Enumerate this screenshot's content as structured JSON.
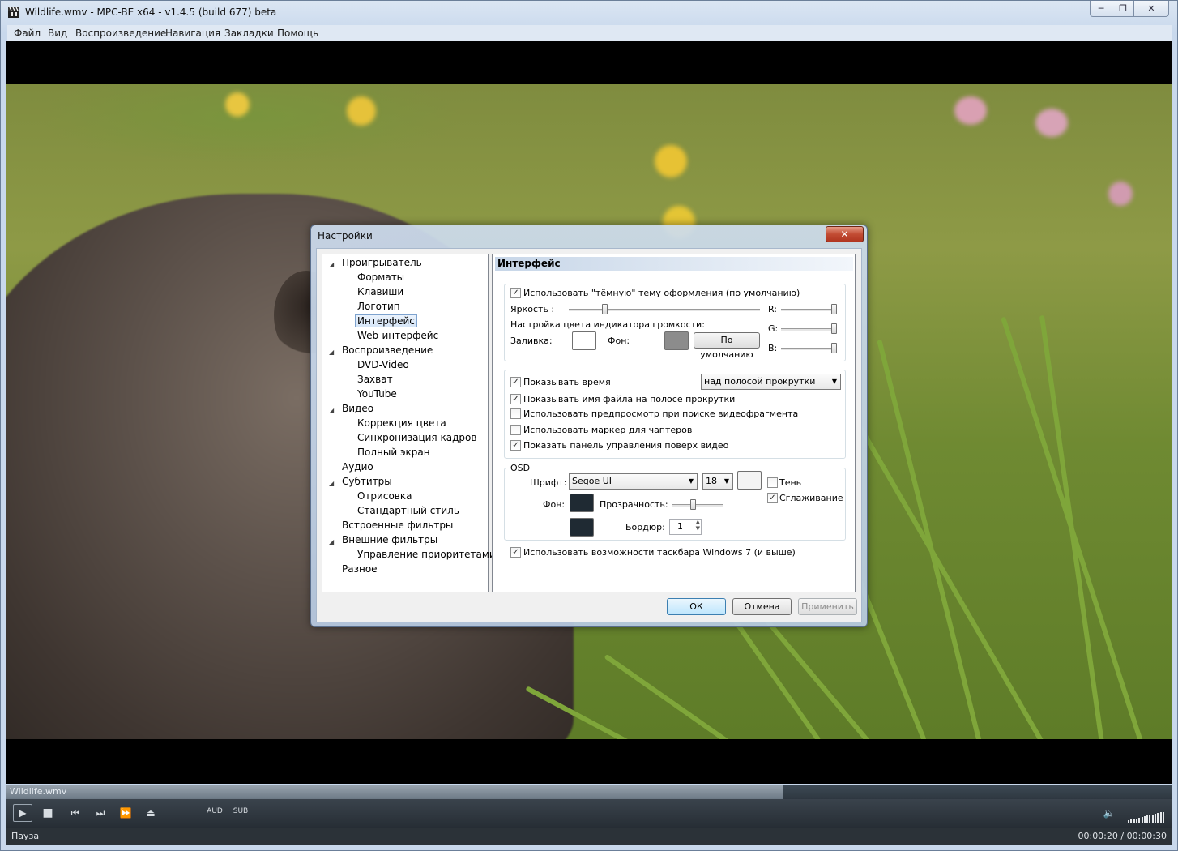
{
  "window": {
    "title": "Wildlife.wmv - MPC-BE x64 - v1.4.5 (build 677) beta"
  },
  "menu": [
    "Файл",
    "Вид",
    "Воспроизведение",
    "Навигация",
    "Закладки",
    "Помощь"
  ],
  "dialog": {
    "title": "Настройки",
    "tree": [
      {
        "label": "Проигрыватель"
      },
      {
        "label": "Форматы"
      },
      {
        "label": "Клавиши"
      },
      {
        "label": "Логотип"
      },
      {
        "label": "Интерфейс",
        "selected": true
      },
      {
        "label": "Web-интерфейс"
      },
      {
        "label": "Воспроизведение"
      },
      {
        "label": "DVD-Video"
      },
      {
        "label": "Захват"
      },
      {
        "label": "YouTube"
      },
      {
        "label": "Видео"
      },
      {
        "label": "Коррекция цвета"
      },
      {
        "label": "Синхронизация кадров"
      },
      {
        "label": "Полный экран"
      },
      {
        "label": "Аудио"
      },
      {
        "label": "Субтитры"
      },
      {
        "label": "Отрисовка"
      },
      {
        "label": "Стандартный стиль"
      },
      {
        "label": "Встроенные фильтры"
      },
      {
        "label": "Внешние фильтры"
      },
      {
        "label": "Управление приоритетами"
      },
      {
        "label": "Разное"
      }
    ],
    "page": {
      "heading": "Интерфейс",
      "dark_theme": {
        "label": "Использовать \"тёмную\" тему оформления (по умолчанию)",
        "checked": true
      },
      "brightness_label": "Яркость :",
      "brightness_value": 0.18,
      "volume_color_label": "Настройка цвета индикатора громкости:",
      "fill_label": "Заливка:",
      "bg_label": "Фон:",
      "default_button": "По умолчанию",
      "r_label": "R:",
      "g_label": "G:",
      "b_label": "B:",
      "show_time": {
        "label": "Показывать время",
        "checked": true
      },
      "time_position": "над полосой прокрутки",
      "show_filename": {
        "label": "Показывать имя файла на полосе прокрутки",
        "checked": true
      },
      "use_preview": {
        "label": "Использовать предпросмотр при поиске видеофрагмента",
        "checked": false
      },
      "use_chapter_marker": {
        "label": "Использовать маркер для чаптеров",
        "checked": false
      },
      "show_control_panel": {
        "label": "Показать панель управления поверх видео",
        "checked": true
      },
      "osd": {
        "group_label": "OSD",
        "font_label": "Шрифт:",
        "font_value": "Segoe UI",
        "size_value": "18",
        "shadow": {
          "label": "Тень",
          "checked": false
        },
        "smoothing": {
          "label": "Сглаживание",
          "checked": true
        },
        "bg_label": "Фон:",
        "transparency_label": "Прозрачность:",
        "transparency_value": 0.4,
        "border_label": "Бордюр:",
        "border_value": "1"
      },
      "taskbar": {
        "label": "Использовать возможности таскбара Windows 7 (и выше)",
        "checked": true
      }
    },
    "buttons": {
      "ok": "ОК",
      "cancel": "Отмена",
      "apply": "Применить"
    }
  },
  "player": {
    "filename": "Wildlife.wmv",
    "seek_progress": 0.667,
    "aud_label": "AUD",
    "sub_label": "SUB",
    "status": "Пауза",
    "time": "00:00:20 / 00:00:30"
  },
  "colors": {
    "osd_bg": "#1f2a33",
    "fill_swatch": "#ffffff",
    "bg_swatch": "#8c8c8c"
  }
}
